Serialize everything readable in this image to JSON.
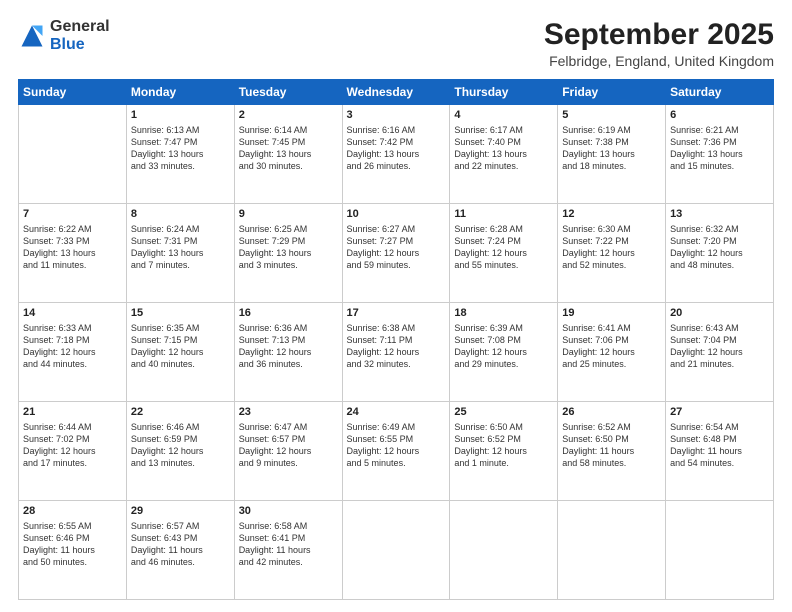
{
  "header": {
    "logo": {
      "general": "General",
      "blue": "Blue"
    },
    "title": "September 2025",
    "location": "Felbridge, England, United Kingdom"
  },
  "days_of_week": [
    "Sunday",
    "Monday",
    "Tuesday",
    "Wednesday",
    "Thursday",
    "Friday",
    "Saturday"
  ],
  "weeks": [
    [
      {
        "day": "",
        "info": ""
      },
      {
        "day": "1",
        "info": "Sunrise: 6:13 AM\nSunset: 7:47 PM\nDaylight: 13 hours\nand 33 minutes."
      },
      {
        "day": "2",
        "info": "Sunrise: 6:14 AM\nSunset: 7:45 PM\nDaylight: 13 hours\nand 30 minutes."
      },
      {
        "day": "3",
        "info": "Sunrise: 6:16 AM\nSunset: 7:42 PM\nDaylight: 13 hours\nand 26 minutes."
      },
      {
        "day": "4",
        "info": "Sunrise: 6:17 AM\nSunset: 7:40 PM\nDaylight: 13 hours\nand 22 minutes."
      },
      {
        "day": "5",
        "info": "Sunrise: 6:19 AM\nSunset: 7:38 PM\nDaylight: 13 hours\nand 18 minutes."
      },
      {
        "day": "6",
        "info": "Sunrise: 6:21 AM\nSunset: 7:36 PM\nDaylight: 13 hours\nand 15 minutes."
      }
    ],
    [
      {
        "day": "7",
        "info": "Sunrise: 6:22 AM\nSunset: 7:33 PM\nDaylight: 13 hours\nand 11 minutes."
      },
      {
        "day": "8",
        "info": "Sunrise: 6:24 AM\nSunset: 7:31 PM\nDaylight: 13 hours\nand 7 minutes."
      },
      {
        "day": "9",
        "info": "Sunrise: 6:25 AM\nSunset: 7:29 PM\nDaylight: 13 hours\nand 3 minutes."
      },
      {
        "day": "10",
        "info": "Sunrise: 6:27 AM\nSunset: 7:27 PM\nDaylight: 12 hours\nand 59 minutes."
      },
      {
        "day": "11",
        "info": "Sunrise: 6:28 AM\nSunset: 7:24 PM\nDaylight: 12 hours\nand 55 minutes."
      },
      {
        "day": "12",
        "info": "Sunrise: 6:30 AM\nSunset: 7:22 PM\nDaylight: 12 hours\nand 52 minutes."
      },
      {
        "day": "13",
        "info": "Sunrise: 6:32 AM\nSunset: 7:20 PM\nDaylight: 12 hours\nand 48 minutes."
      }
    ],
    [
      {
        "day": "14",
        "info": "Sunrise: 6:33 AM\nSunset: 7:18 PM\nDaylight: 12 hours\nand 44 minutes."
      },
      {
        "day": "15",
        "info": "Sunrise: 6:35 AM\nSunset: 7:15 PM\nDaylight: 12 hours\nand 40 minutes."
      },
      {
        "day": "16",
        "info": "Sunrise: 6:36 AM\nSunset: 7:13 PM\nDaylight: 12 hours\nand 36 minutes."
      },
      {
        "day": "17",
        "info": "Sunrise: 6:38 AM\nSunset: 7:11 PM\nDaylight: 12 hours\nand 32 minutes."
      },
      {
        "day": "18",
        "info": "Sunrise: 6:39 AM\nSunset: 7:08 PM\nDaylight: 12 hours\nand 29 minutes."
      },
      {
        "day": "19",
        "info": "Sunrise: 6:41 AM\nSunset: 7:06 PM\nDaylight: 12 hours\nand 25 minutes."
      },
      {
        "day": "20",
        "info": "Sunrise: 6:43 AM\nSunset: 7:04 PM\nDaylight: 12 hours\nand 21 minutes."
      }
    ],
    [
      {
        "day": "21",
        "info": "Sunrise: 6:44 AM\nSunset: 7:02 PM\nDaylight: 12 hours\nand 17 minutes."
      },
      {
        "day": "22",
        "info": "Sunrise: 6:46 AM\nSunset: 6:59 PM\nDaylight: 12 hours\nand 13 minutes."
      },
      {
        "day": "23",
        "info": "Sunrise: 6:47 AM\nSunset: 6:57 PM\nDaylight: 12 hours\nand 9 minutes."
      },
      {
        "day": "24",
        "info": "Sunrise: 6:49 AM\nSunset: 6:55 PM\nDaylight: 12 hours\nand 5 minutes."
      },
      {
        "day": "25",
        "info": "Sunrise: 6:50 AM\nSunset: 6:52 PM\nDaylight: 12 hours\nand 1 minute."
      },
      {
        "day": "26",
        "info": "Sunrise: 6:52 AM\nSunset: 6:50 PM\nDaylight: 11 hours\nand 58 minutes."
      },
      {
        "day": "27",
        "info": "Sunrise: 6:54 AM\nSunset: 6:48 PM\nDaylight: 11 hours\nand 54 minutes."
      }
    ],
    [
      {
        "day": "28",
        "info": "Sunrise: 6:55 AM\nSunset: 6:46 PM\nDaylight: 11 hours\nand 50 minutes."
      },
      {
        "day": "29",
        "info": "Sunrise: 6:57 AM\nSunset: 6:43 PM\nDaylight: 11 hours\nand 46 minutes."
      },
      {
        "day": "30",
        "info": "Sunrise: 6:58 AM\nSunset: 6:41 PM\nDaylight: 11 hours\nand 42 minutes."
      },
      {
        "day": "",
        "info": ""
      },
      {
        "day": "",
        "info": ""
      },
      {
        "day": "",
        "info": ""
      },
      {
        "day": "",
        "info": ""
      }
    ]
  ]
}
